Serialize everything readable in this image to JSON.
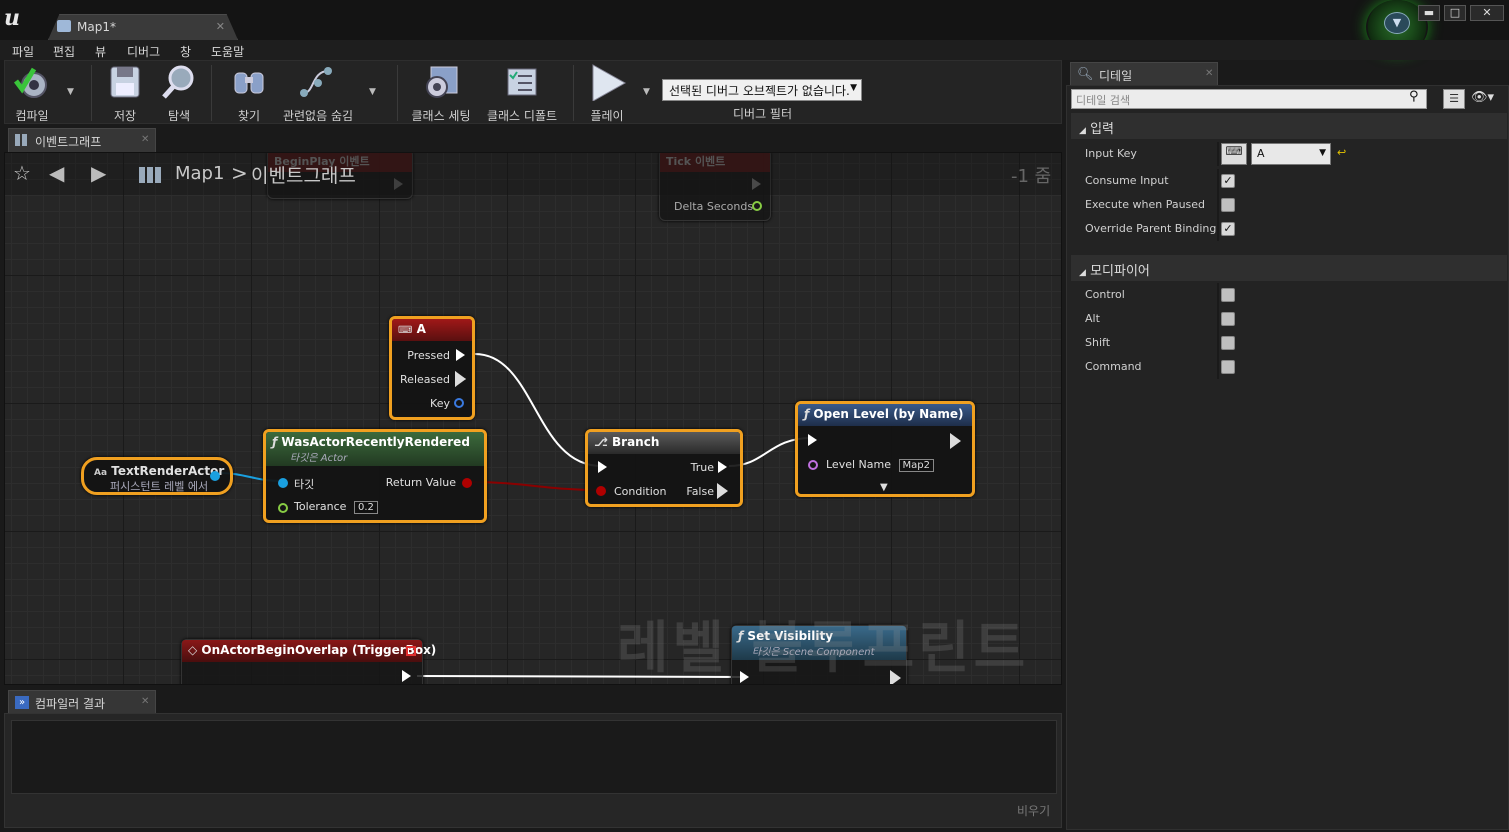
{
  "window": {
    "tab_title": "Map1*",
    "buttons": {
      "minimize": "▬",
      "maximize": "□",
      "close": "✕"
    }
  },
  "menu": [
    "파일",
    "편집",
    "뷰",
    "디버그",
    "창",
    "도움말"
  ],
  "toolbar": {
    "compile": "컴파일",
    "save": "저장",
    "browse": "탐색",
    "find": "찾기",
    "hide_unrelated": "관련없음 숨김",
    "class_settings": "클래스 세팅",
    "class_defaults": "클래스 디폴트",
    "play": "플레이",
    "debug_select": "선택된 디버그 오브젝트가 없습니다.",
    "debug_filter": "디버그 필터"
  },
  "graph_tab": {
    "label": "이벤트그래프"
  },
  "graph": {
    "breadcrumb_map": "Map1",
    "breadcrumb_sep": ">",
    "breadcrumb_graph": "이벤트그래프",
    "zoom": "-1 줌",
    "watermark": "레벨 블루프린트"
  },
  "nodes": {
    "begin_play": {
      "title": "BeginPlay 이벤트"
    },
    "tick": {
      "title": "Tick 이벤트",
      "pin_delta": "Delta Seconds"
    },
    "key_a": {
      "title": "A",
      "pin_pressed": "Pressed",
      "pin_released": "Released",
      "pin_key": "Key"
    },
    "text_render_actor": {
      "title": "TextRenderActor",
      "subtitle": "퍼시스턴트 레벨 에서"
    },
    "was_rendered": {
      "title": "WasActorRecentlyRendered",
      "subtitle": "타깃은 Actor",
      "pin_target": "타깃",
      "pin_tolerance": "Tolerance",
      "tolerance_value": "0.2",
      "pin_return": "Return Value"
    },
    "branch": {
      "title": "Branch",
      "pin_condition": "Condition",
      "pin_true": "True",
      "pin_false": "False"
    },
    "open_level": {
      "title": "Open Level (by Name)",
      "pin_level_name": "Level Name",
      "level_name_value": "Map2"
    },
    "overlap": {
      "title": "OnActorBeginOverlap (TriggerBox)"
    },
    "set_visibility": {
      "title": "Set Visibility",
      "subtitle": "타깃은 Scene Component"
    }
  },
  "compiler": {
    "tab_label": "컴파일러 결과",
    "clear": "비우기"
  },
  "details": {
    "tab_label": "디테일",
    "search_placeholder": "디테일 검색",
    "input_category": "입력",
    "modifier_category": "모디파이어",
    "input_key_label": "Input Key",
    "input_key_value": "A",
    "props": [
      {
        "label": "Consume Input",
        "checked": true
      },
      {
        "label": "Execute when Paused",
        "checked": false
      },
      {
        "label": "Override Parent Binding",
        "checked": true
      }
    ],
    "modifiers": [
      {
        "label": "Control",
        "checked": false
      },
      {
        "label": "Alt",
        "checked": false
      },
      {
        "label": "Shift",
        "checked": false
      },
      {
        "label": "Command",
        "checked": false
      }
    ]
  },
  "colors": {
    "selection_border": "#f0a020",
    "event_header": "#8a1a1a",
    "function_header": "#2a4a2a",
    "pure_header": "#3a4a6a",
    "exec_wire": "#ffffff",
    "bool_wire": "#8a0000",
    "object_wire": "#1aa0e0"
  }
}
